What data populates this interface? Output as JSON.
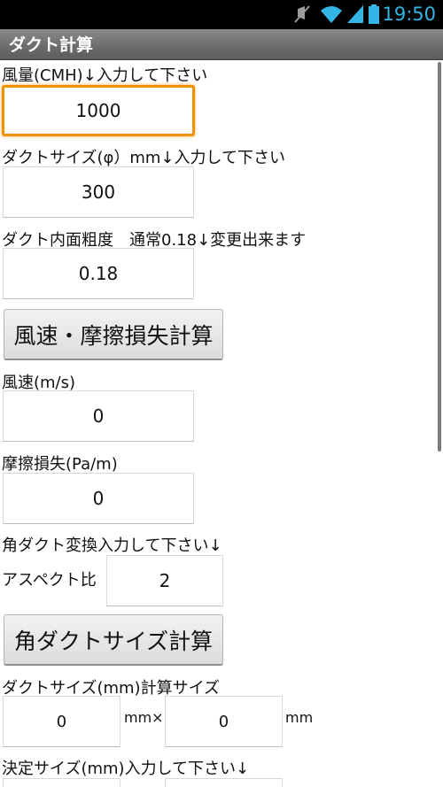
{
  "status_bar": {
    "time": "19:50",
    "icons": [
      "mute-icon",
      "wifi-icon",
      "signal-icon",
      "battery-icon"
    ]
  },
  "app": {
    "title": "ダクト計算"
  },
  "form": {
    "airflow_label": "風量(CMH)↓入力して下さい",
    "airflow_value": "1000",
    "duct_size_label": "ダクトサイズ(φ）mm↓入力して下さい",
    "duct_size_value": "300",
    "roughness_label": "ダクト内面粗度　通常0.18↓変更出来ます",
    "roughness_value": "0.18",
    "calc_button": "風速・摩擦損失計算",
    "velocity_label": "風速(m/s)",
    "velocity_value": "0",
    "friction_label": "摩擦損失(Pa/m)",
    "friction_value": "0",
    "rect_header": "角ダクト変換入力して下さい↓",
    "aspect_label": "アスペクト比",
    "aspect_value": "2",
    "rect_button": "角ダクトサイズ計算",
    "calc_size_label": "ダクトサイズ(mm)計算サイズ",
    "calc_w": "0",
    "mmx": "mm×",
    "calc_h": "0",
    "mm": "mm",
    "decided_label": "決定サイズ(mm)入力して下さい↓"
  },
  "colors": {
    "focus": "#f29100",
    "status_accent": "#33b5e5"
  }
}
